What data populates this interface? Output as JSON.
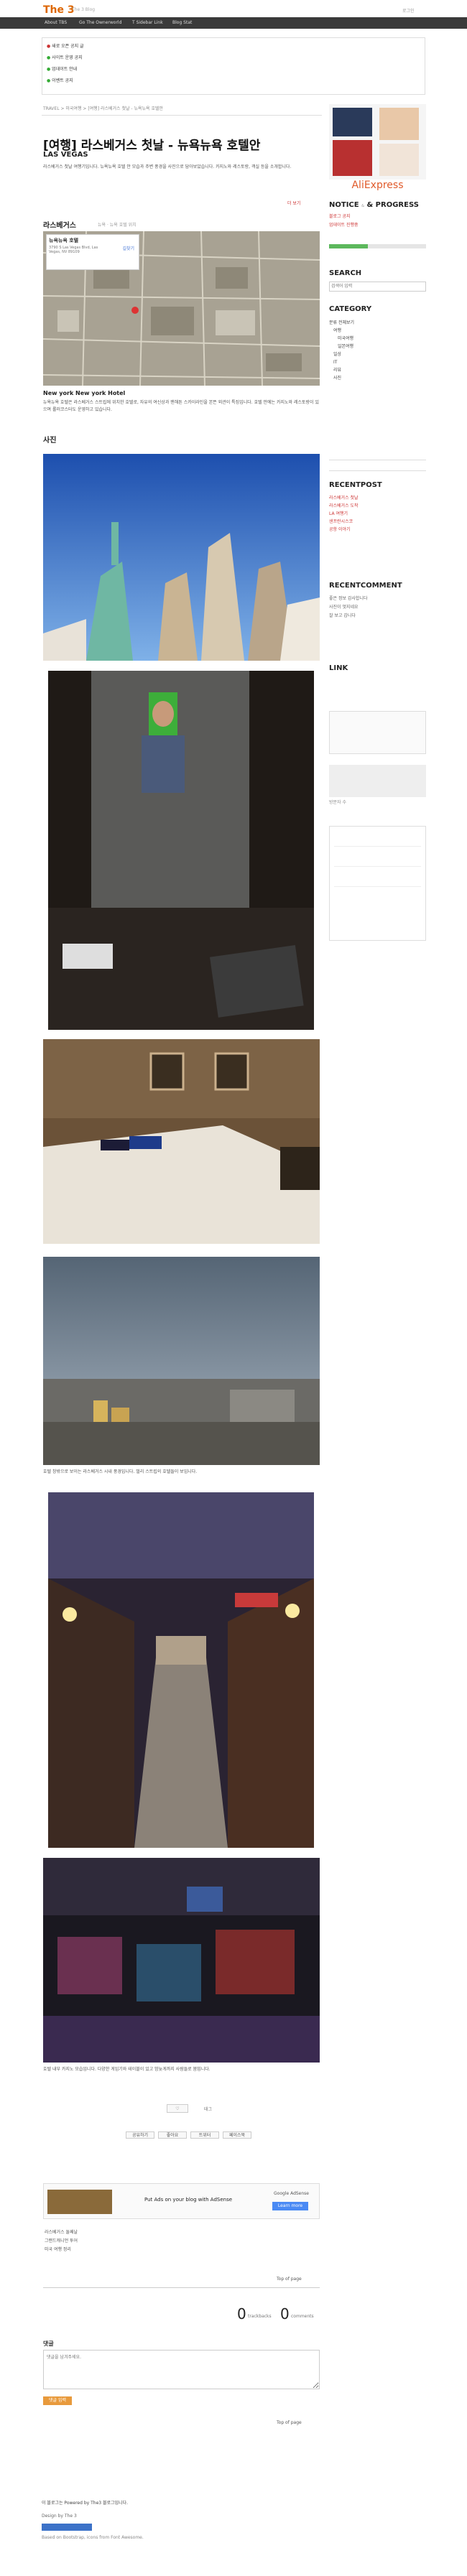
{
  "header": {
    "logo": "The",
    "logo_num": "3",
    "logo_sub": "The 3 Blog",
    "login": "로그인"
  },
  "nav": [
    "About TBS",
    "Go The Ownerworld",
    "T Sidebar Link",
    "Blog Stat"
  ],
  "notice": {
    "lines": [
      "새로 오픈 공지 글",
      "사이트 운영 공지",
      "업데이트 안내",
      "이벤트 공지"
    ]
  },
  "breadcrumb": "TRAVEL > 미국여행 > [여행] 라스베거스 첫날 - 뉴욕뉴욕 호텔안",
  "post": {
    "title": "[여행] 라스베거스 첫날 - 뉴욕뉴욕 호텔안",
    "subtitle": "LAS VEGAS",
    "intro": "라스베거스 첫날 여행기입니다. 뉴욕뉴욕 호텔 안 모습과 주변 풍경을 사진으로 담아보았습니다. 카지노와 레스토랑, 객실 등을 소개합니다.",
    "read_more": "더 보기",
    "section_location": "라스베거스",
    "section_location_sub": "뉴욕 · 뉴욕 호텔 위치",
    "map_card": {
      "title": "뉴욕뉴욕 호텔",
      "address": "3790 S Las Vegas Blvd, Las Vegas, NV 89109",
      "link": "길찾기"
    },
    "hotel_heading": "New york New york Hotel",
    "hotel_text": "뉴욕뉴욕 호텔은 라스베거스 스트립에 위치한 호텔로, 자유의 여신상과 맨해튼 스카이라인을 본뜬 외관이 특징입니다. 호텔 안에는 카지노와 레스토랑이 있으며 롤러코스터도 운영하고 있습니다.",
    "section_photo": "사진",
    "caption1": "호텔 창밖으로 보이는 라스베거스 시내 풍경입니다. 멀리 스트립의 호텔들이 보입니다.",
    "caption2": "호텔 내부 카지노 모습입니다. 다양한 게임기와 테이블이 있고 밤늦게까지 사람들로 붐빕니다.",
    "tags_label": "태그",
    "share": [
      "공유하기",
      "좋아요",
      "트위터",
      "페이스북"
    ],
    "ad": {
      "text": "Put Ads on your blog with AdSense",
      "label": "Google AdSense",
      "btn": "Learn more"
    },
    "related": [
      "라스베거스 둘째날",
      "그랜드캐니언 투어",
      "미국 여행 정리"
    ],
    "top": "Top of page",
    "trackback_count": "0",
    "comments_count": "0",
    "trackback_label": "trackbacks",
    "comments_label": "comments",
    "comment_title": "댓글",
    "comment_placeholder": "댓글을 남겨주세요.",
    "comment_btn": "댓글 입력"
  },
  "footer": {
    "text": "이 블로그는 Powered by The3 블로그입니다.",
    "design": "Design by The 3",
    "credit": "Based on Bootstrap, icons from Font Awesome."
  },
  "sidebar": {
    "ad_brand": "AliExpress",
    "notice_title": "NOTICE",
    "notice_sub": "& PROGRESS",
    "notice_items": [
      "블로그 공지",
      "업데이트 진행중"
    ],
    "search_title": "SEARCH",
    "search_placeholder": "검색어 입력",
    "category_title": "CATEGORY",
    "categories": [
      "분류 전체보기",
      "여행",
      "미국여행",
      "일본여행",
      "일상",
      "IT",
      "리뷰",
      "사진"
    ],
    "recentpost_title": "RECENTPOST",
    "recentposts": [
      "라스베거스 첫날",
      "라스베거스 도착",
      "LA 여행기",
      "샌프란시스코",
      "공항 이야기"
    ],
    "recentcomment_title": "RECENTCOMMENT",
    "recentcomments": [
      "좋은 정보 감사합니다",
      "사진이 멋지네요",
      "잘 보고 갑니다"
    ],
    "link_title": "LINK",
    "counter": "방문자 수"
  }
}
